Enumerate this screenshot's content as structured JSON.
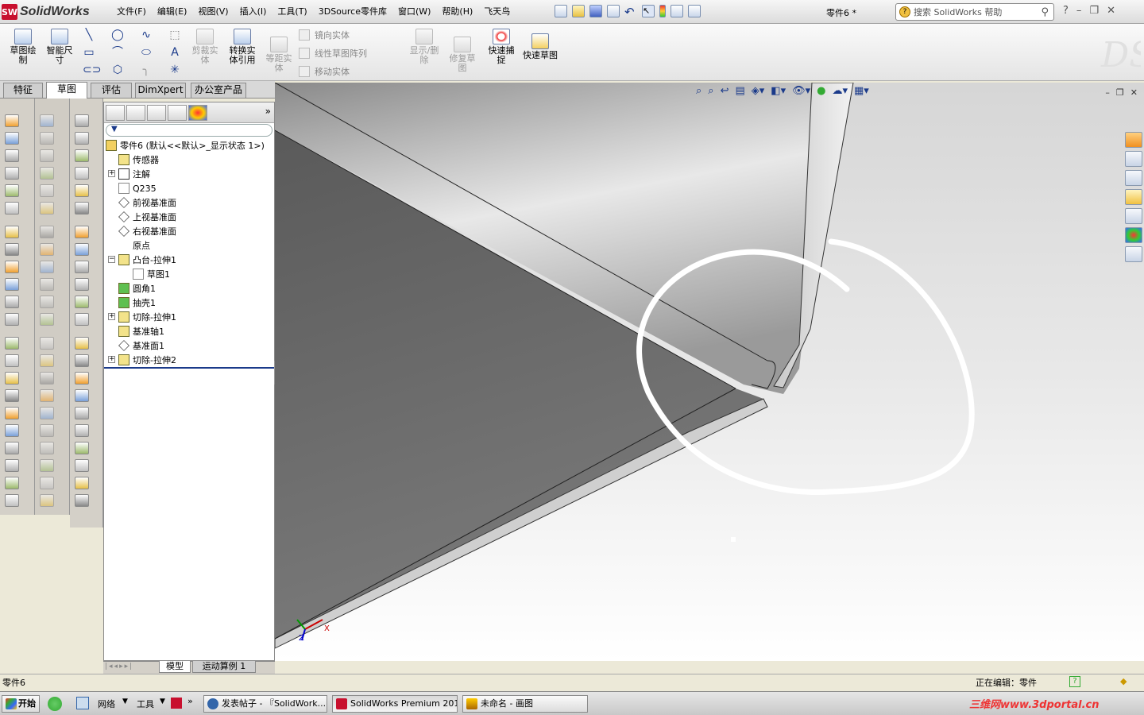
{
  "app": {
    "logo_text": "SolidWorks",
    "doc_title": "零件6 *"
  },
  "menu": [
    "文件(F)",
    "编辑(E)",
    "视图(V)",
    "插入(I)",
    "工具(T)",
    "3DSource零件库",
    "窗口(W)",
    "帮助(H)",
    "飞天鸟"
  ],
  "search": {
    "placeholder": "搜索 SolidWorks 帮助"
  },
  "window_controls": [
    "?",
    "–",
    "❐",
    "✕"
  ],
  "ribbon": {
    "sketch": "草图绘制",
    "smart_dim": "智能尺寸",
    "trim": "剪裁实体",
    "convert": "转换实体引用",
    "offset": "等距实体",
    "mirror": "镜向实体",
    "linear_pattern": "线性草图阵列",
    "move": "移动实体",
    "display_delete": "显示/删除",
    "repair": "修复草图",
    "quick_snap": "快速捕捉",
    "rapid_sketch": "快速草图"
  },
  "tabs": [
    "特征",
    "草图",
    "评估",
    "DimXpert",
    "办公室产品"
  ],
  "active_tab": "草图",
  "tree": {
    "root": "零件6 (默认<<默认>_显示状态 1>)",
    "items": [
      {
        "label": "传感器",
        "indent": 1,
        "expandable": false
      },
      {
        "label": "注解",
        "indent": 1,
        "expandable": true
      },
      {
        "label": "Q235",
        "indent": 1,
        "expandable": false
      },
      {
        "label": "前视基准面",
        "indent": 1,
        "expandable": false
      },
      {
        "label": "上视基准面",
        "indent": 1,
        "expandable": false
      },
      {
        "label": "右视基准面",
        "indent": 1,
        "expandable": false
      },
      {
        "label": "原点",
        "indent": 1,
        "expandable": false
      },
      {
        "label": "凸台-拉伸1",
        "indent": 1,
        "expandable": true
      },
      {
        "label": "草图1",
        "indent": 2,
        "expandable": false
      },
      {
        "label": "圆角1",
        "indent": 1,
        "expandable": false
      },
      {
        "label": "抽壳1",
        "indent": 1,
        "expandable": false
      },
      {
        "label": "切除-拉伸1",
        "indent": 1,
        "expandable": true
      },
      {
        "label": "基准轴1",
        "indent": 1,
        "expandable": false
      },
      {
        "label": "基准面1",
        "indent": 1,
        "expandable": false
      },
      {
        "label": "切除-拉伸2",
        "indent": 1,
        "expandable": true
      }
    ]
  },
  "tree_bottom_tabs": [
    "模型",
    "运动算例 1"
  ],
  "triad": {
    "x": "X",
    "y": "Y",
    "z": "Z"
  },
  "status": {
    "left": "零件6",
    "editing": "正在编辑：零件"
  },
  "taskbar": {
    "start": "开始",
    "network": "网络",
    "tools": "工具",
    "tasks": [
      "发表帖子 - 『SolidWork...",
      "SolidWorks Premium 201...",
      "未命名 - 画图"
    ],
    "watermark": "三维网www.3dportal.cn"
  },
  "colors": {
    "accent": "#1a3a8a",
    "annotation": "#ffffff",
    "sw_red": "#c8102e"
  }
}
